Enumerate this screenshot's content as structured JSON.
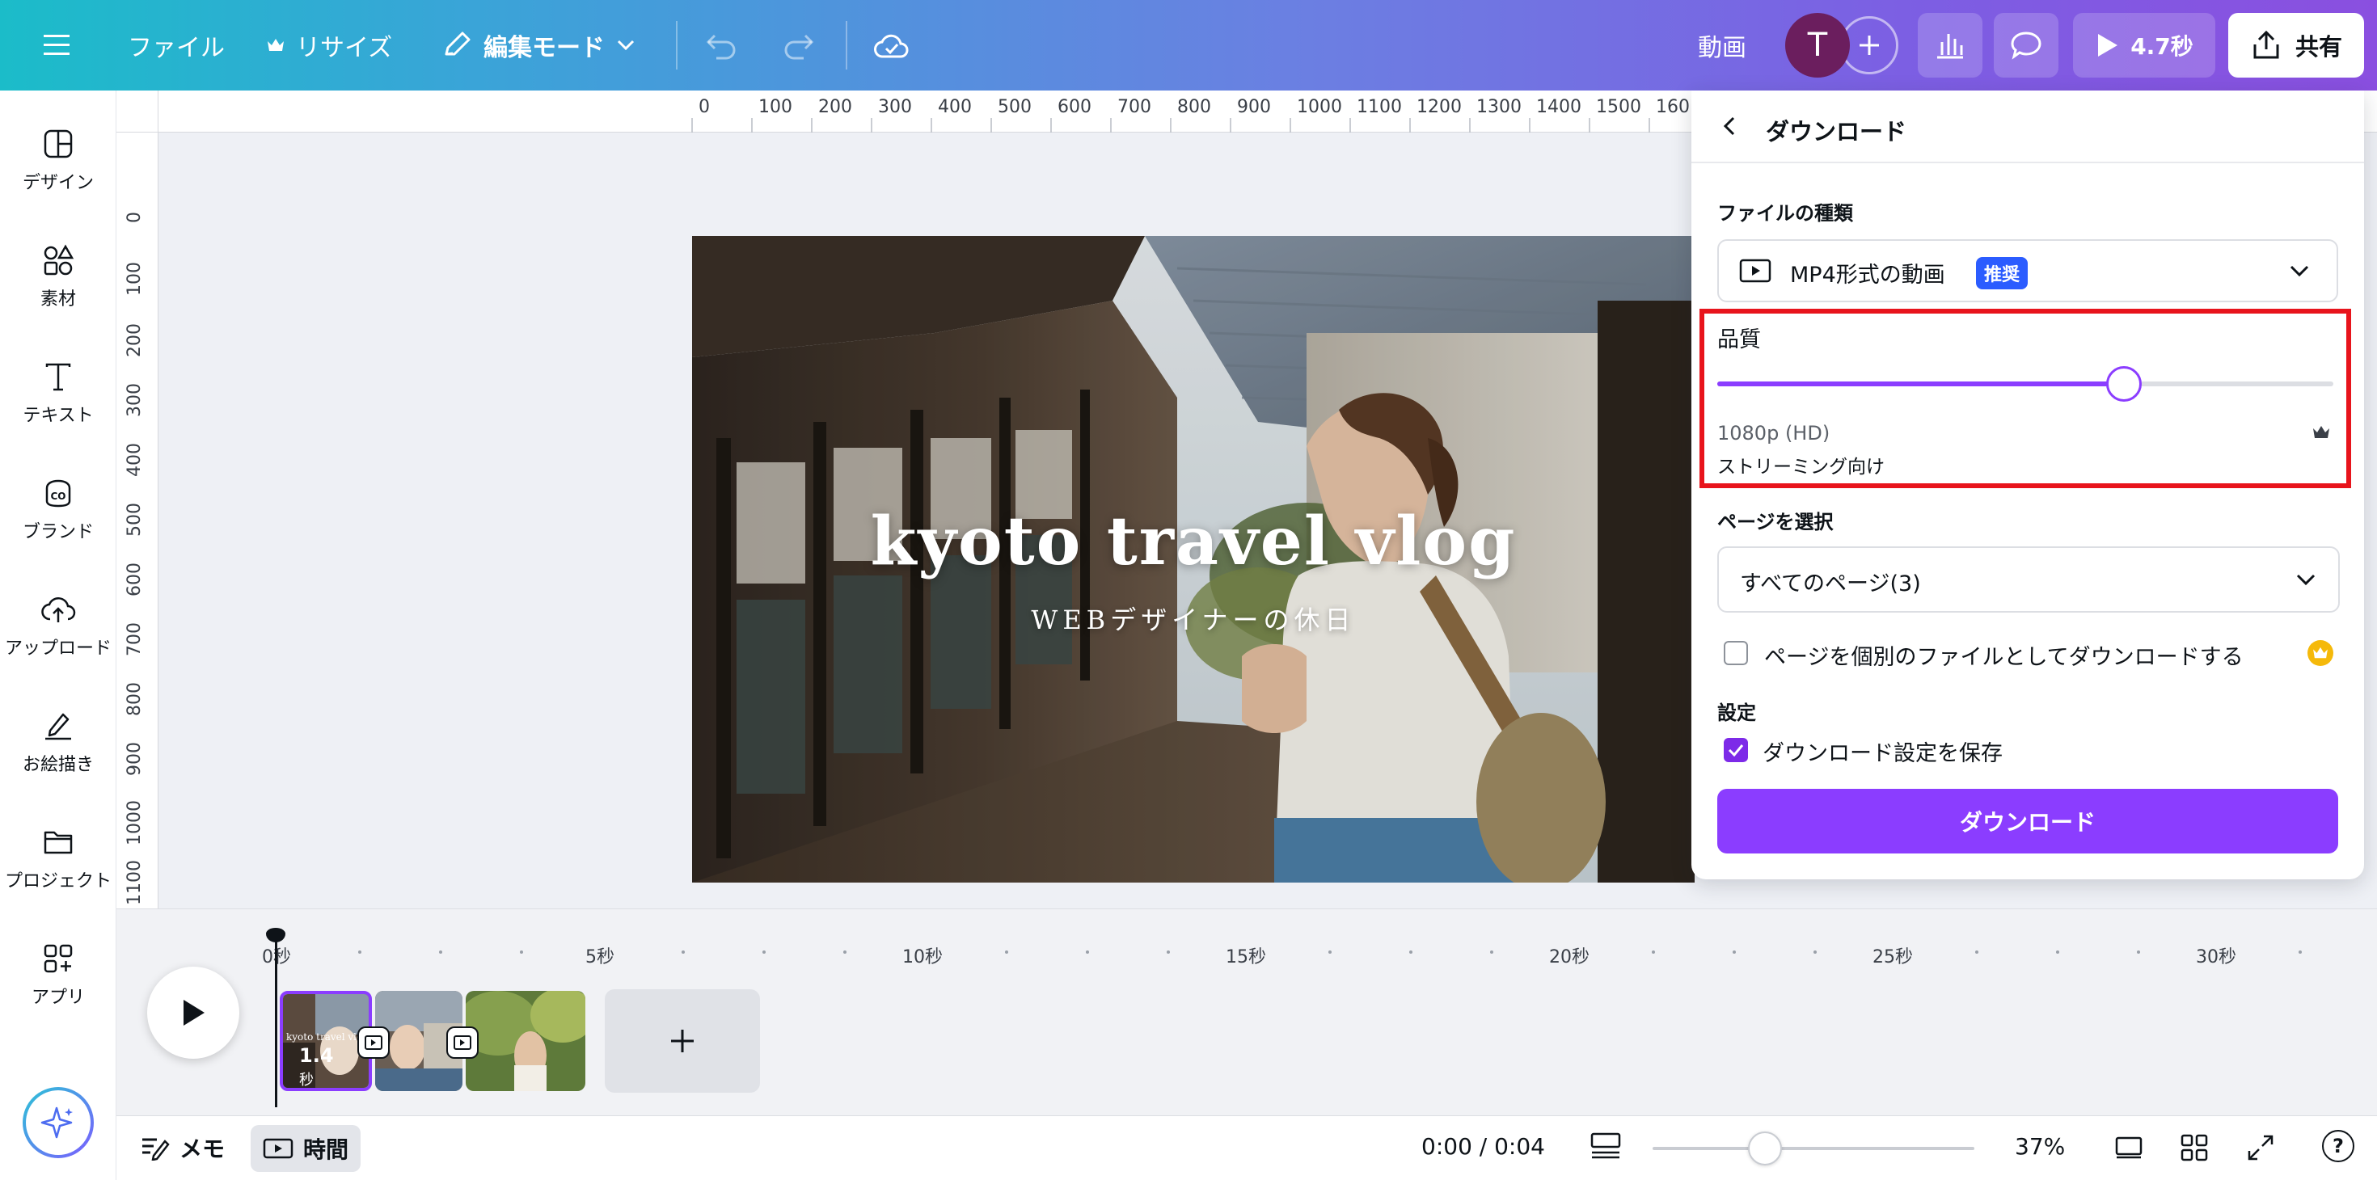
{
  "topbar": {
    "file_label": "ファイル",
    "resize_label": "リサイズ",
    "edit_mode_label": "編集モード",
    "media_label": "動画",
    "avatar_initial": "T",
    "play_duration": "4.7秒",
    "share_label": "共有",
    "gradient_colors": [
      "#1bbcc9",
      "#6b7fe2",
      "#8a4fe0"
    ]
  },
  "sidebar": {
    "items": [
      {
        "label": "デザイン",
        "icon": "layout-icon"
      },
      {
        "label": "素材",
        "icon": "elements-icon"
      },
      {
        "label": "テキスト",
        "icon": "text-icon"
      },
      {
        "label": "ブランド",
        "icon": "brand-icon"
      },
      {
        "label": "アップロード",
        "icon": "cloud-upload-icon"
      },
      {
        "label": "お絵描き",
        "icon": "draw-icon"
      },
      {
        "label": "プロジェクト",
        "icon": "folder-icon"
      },
      {
        "label": "アプリ",
        "icon": "apps-icon"
      }
    ]
  },
  "ruler": {
    "top": [
      "0",
      "100",
      "200",
      "300",
      "400",
      "500",
      "600",
      "700",
      "800",
      "900",
      "1000",
      "1100",
      "1200",
      "1300",
      "1400",
      "1500",
      "160"
    ],
    "left": [
      "0",
      "100",
      "200",
      "300",
      "400",
      "500",
      "600",
      "700",
      "800",
      "900",
      "1000",
      "1100"
    ]
  },
  "canvas": {
    "title": "kyoto travel vlog",
    "subtitle": "WEBデザイナーの休日"
  },
  "download_panel": {
    "title": "ダウンロード",
    "file_type_label": "ファイルの種類",
    "file_type_value": "MP4形式の動画",
    "recommended_badge": "推奨",
    "quality_label": "品質",
    "quality_level": 0.66,
    "quality_resolution": "1080p (HD)",
    "quality_description": "ストリーミング向け",
    "page_select_label": "ページを選択",
    "page_select_value": "すべてのページ(3)",
    "separate_files_label": "ページを個別のファイルとしてダウンロードする",
    "separate_files_checked": false,
    "settings_label": "設定",
    "save_settings_label": "ダウンロード設定を保存",
    "save_settings_checked": true,
    "download_button": "ダウンロード",
    "accent_color": "#8b3dff",
    "highlight_color": "#e8141c"
  },
  "timeline": {
    "markers": [
      "0秒",
      "5秒",
      "10秒",
      "15秒",
      "20秒",
      "25秒",
      "30秒"
    ],
    "clip1_duration": "1.4",
    "clip1_unit": "秒",
    "clip1_overlay_text": "kyoto travel vlog"
  },
  "bottombar": {
    "notes_label": "メモ",
    "time_label": "時間",
    "timecode": "0:00 / 0:04",
    "zoom": "37%"
  }
}
